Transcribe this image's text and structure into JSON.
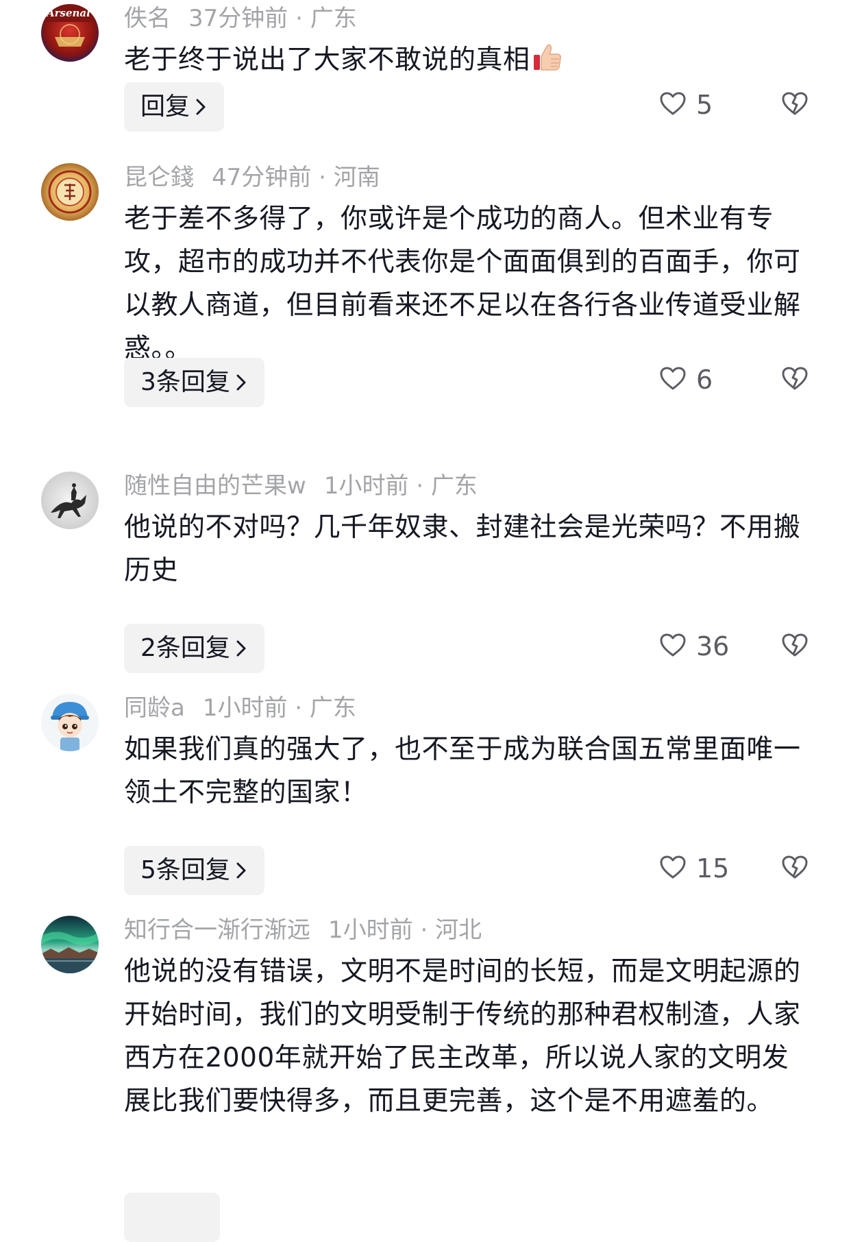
{
  "comments": [
    {
      "username": "佚名",
      "time": "37分钟前",
      "location": "广东",
      "text": "老于终于说出了大家不敢说的真相",
      "emoji": "thumbs-up-icon",
      "reply_label": "回复",
      "likes": "5",
      "avatar": {
        "icon": "arsenal-logo-avatar",
        "text": "Arsenal"
      }
    },
    {
      "username": "昆仑錢",
      "time": "47分钟前",
      "location": "河南",
      "text": "老于差不多得了，你或许是个成功的商人。但术业有专攻，超市的成功并不代表你是个面面俱到的百面手，你可以教人商道，但目前看来还不足以在各行各业传道受业解惑。。",
      "reply_label": "3条回复",
      "likes": "6",
      "avatar": {
        "icon": "gold-seal-avatar"
      }
    },
    {
      "username": "随性自由的芒果w",
      "time": "1小时前",
      "location": "广东",
      "text": "他说的不对吗？几千年奴隶、封建社会是光荣吗？不用搬历史",
      "reply_label": "2条回复",
      "likes": "36",
      "avatar": {
        "icon": "horse-rider-avatar"
      }
    },
    {
      "username": "同龄a",
      "time": "1小时前",
      "location": "广东",
      "text": "如果我们真的强大了，也不至于成为联合国五常里面唯一领土不完整的国家！",
      "reply_label": "5条回复",
      "likes": "15",
      "avatar": {
        "icon": "cartoon-boy-avatar"
      }
    },
    {
      "username": "知行合一渐行渐远",
      "time": "1小时前",
      "location": "河北",
      "text": "他说的没有错误，文明不是时间的长短，而是文明起源的开始时间，我们的文明受制于传统的那种君权制渣，人家西方在2000年就开始了民主改革，所以说人家的文明发展比我们要快得多，而且更完善，这个是不用遮羞的。",
      "avatar": {
        "icon": "aurora-landscape-avatar"
      }
    }
  ],
  "separator": "·",
  "icons": {
    "like": "heart-outline-icon",
    "dislike": "broken-heart-icon",
    "reply_chevron": "chevron-right-icon"
  },
  "colors": {
    "meta_text": "#a3a4a8",
    "body_text": "#161823",
    "reply_bg": "#f2f2f3",
    "like_count": "#5b5c63"
  }
}
